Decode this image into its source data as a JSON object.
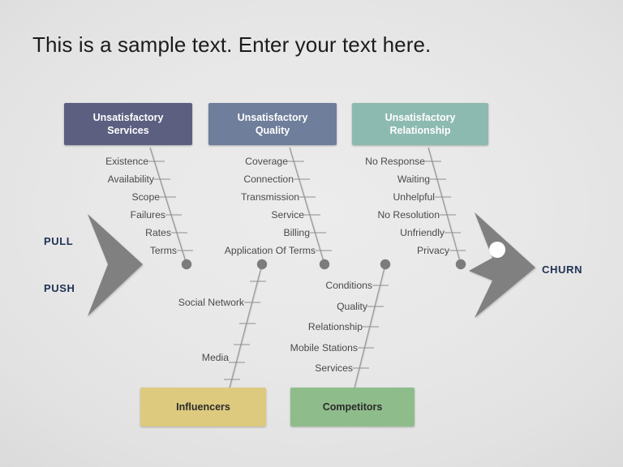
{
  "slide": {
    "title": "This is a sample text. Enter your text here.",
    "background_color": "#e6e6e6"
  },
  "diagram": {
    "type": "fishbone-ishikawa",
    "effect_label": "CHURN",
    "left_captions": {
      "pull": "PULL",
      "push": "PUSH"
    },
    "categories": [
      {
        "id": "unsatisfactory-services",
        "title": "Unsatisfactory\nServices",
        "title_line1": "Unsatisfactory",
        "title_line2": "Services",
        "color": "#5c5f80",
        "text_color": "#ffffff",
        "position": "top",
        "causes": [
          "Existence",
          "Availability",
          "Scope",
          "Failures",
          "Rates",
          "Terms"
        ]
      },
      {
        "id": "unsatisfactory-quality",
        "title_line1": "Unsatisfactory",
        "title_line2": "Quality",
        "color": "#6e7e9b",
        "text_color": "#ffffff",
        "position": "top",
        "causes": [
          "Coverage",
          "Connection",
          "Transmission",
          "Service",
          "Billing",
          "Application Of Terms"
        ]
      },
      {
        "id": "unsatisfactory-relationship",
        "title_line1": "Unsatisfactory",
        "title_line2": "Relationship",
        "color": "#8dbab0",
        "text_color": "#ffffff",
        "position": "top",
        "causes": [
          "No Response",
          "Waiting",
          "Unhelpful",
          "No Resolution",
          "Unfriendly",
          "Privacy"
        ]
      },
      {
        "id": "influencers",
        "title_line1": "Influencers",
        "title_line2": "",
        "color": "#ddca7f",
        "text_color": "#2b2b2b",
        "position": "bottom",
        "causes": [
          "Social Network",
          "Media"
        ]
      },
      {
        "id": "competitors",
        "title_line1": "Competitors",
        "title_line2": "",
        "color": "#8fbc8b",
        "text_color": "#2b2b2b",
        "position": "bottom",
        "causes": [
          "Conditions",
          "Quality",
          "Relationship",
          "Mobile Stations",
          "Services"
        ]
      }
    ],
    "colors": {
      "spine": "#9a9a9a",
      "branch": "#9a9a9a",
      "node": "#7c7c7c",
      "fish_body": "#808080",
      "eye": "#ffffff",
      "caption": "#1f3153",
      "cause_text": "#4a4a4a"
    }
  }
}
